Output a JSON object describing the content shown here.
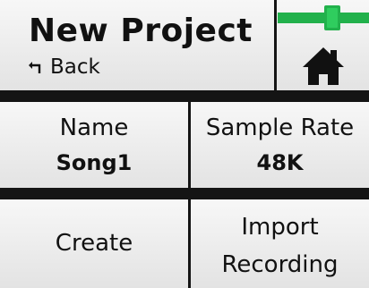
{
  "header": {
    "title": "New Project",
    "back_label": "Back",
    "back_icon": "return-arrow-icon",
    "home_icon": "home-icon",
    "level_icon": "level-meter-icon",
    "level_color": "#22b14c"
  },
  "fields": {
    "name": {
      "label": "Name",
      "value": "Song1"
    },
    "sample_rate": {
      "label": "Sample Rate",
      "value": "48K"
    }
  },
  "actions": {
    "create_label": "Create",
    "import_line1": "Import",
    "import_line2": "Recording"
  }
}
